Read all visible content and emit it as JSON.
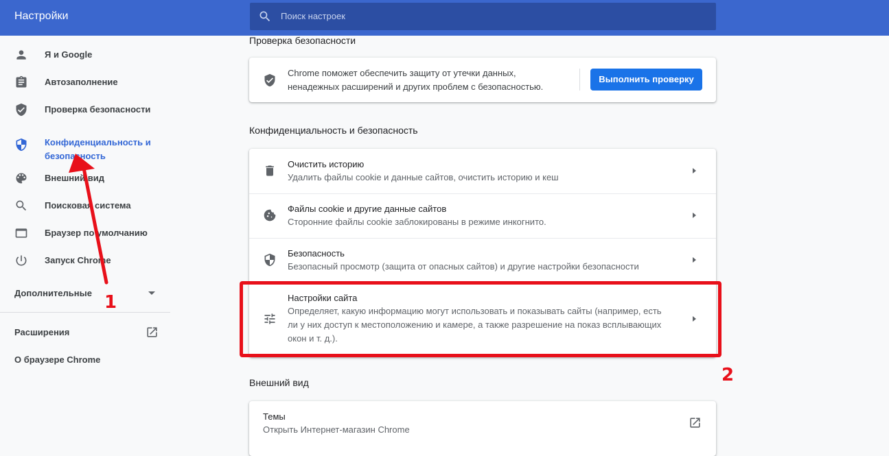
{
  "header": {
    "title": "Настройки",
    "search_placeholder": "Поиск настроек"
  },
  "sidebar": {
    "items": [
      {
        "label": "Я и Google",
        "icon": "person-icon"
      },
      {
        "label": "Автозаполнение",
        "icon": "clipboard-icon"
      },
      {
        "label": "Проверка безопасности",
        "icon": "shield-check-icon"
      },
      {
        "label": "Конфиденциальность и безопасность",
        "icon": "privacy-shield-icon",
        "active": true
      },
      {
        "label": "Внешний вид",
        "icon": "palette-icon"
      },
      {
        "label": "Поисковая система",
        "icon": "search-icon"
      },
      {
        "label": "Браузер по умолчанию",
        "icon": "browser-window-icon"
      },
      {
        "label": "Запуск Chrome",
        "icon": "power-icon"
      }
    ],
    "advanced_label": "Дополнительные",
    "extensions_label": "Расширения",
    "about_label": "О браузере Chrome"
  },
  "safety_check": {
    "section_title": "Проверка безопасности",
    "description_line1": "Chrome поможет обеспечить защиту от утечки данных,",
    "description_line2": "ненадежных расширений и других проблем с безопасностью.",
    "button_label": "Выполнить проверку"
  },
  "privacy": {
    "section_title": "Конфиденциальность и безопасность",
    "rows": [
      {
        "title": "Очистить историю",
        "sub": [
          "Удалить файлы cookie и данные сайтов, очистить историю и кеш"
        ],
        "icon": "trash-icon"
      },
      {
        "title": "Файлы cookie и другие данные сайтов",
        "sub": [
          "Сторонние файлы cookie заблокированы в режиме инкогнито."
        ],
        "icon": "cookie-icon"
      },
      {
        "title": "Безопасность",
        "sub": [
          "Безопасный просмотр (защита от опасных сайтов) и другие настройки безопасности"
        ],
        "icon": "shield-icon"
      },
      {
        "title": "Настройки сайта",
        "sub": [
          "Определяет, какую информацию могут использовать и показывать сайты (например, есть",
          "ли у них доступ к местоположению и камере, а также разрешение на показ всплывающих",
          "окон и т. д.)."
        ],
        "icon": "tune-icon"
      }
    ]
  },
  "appearance": {
    "section_title": "Внешний вид",
    "themes_title": "Темы",
    "themes_sub": "Открыть Интернет-магазин Chrome"
  },
  "annotations": {
    "label1": "1",
    "label2": "2",
    "color": "#e8101a"
  },
  "colors": {
    "header_bg": "#3b67ce",
    "accent": "#1a73e8",
    "active_nav": "#3367d6"
  }
}
